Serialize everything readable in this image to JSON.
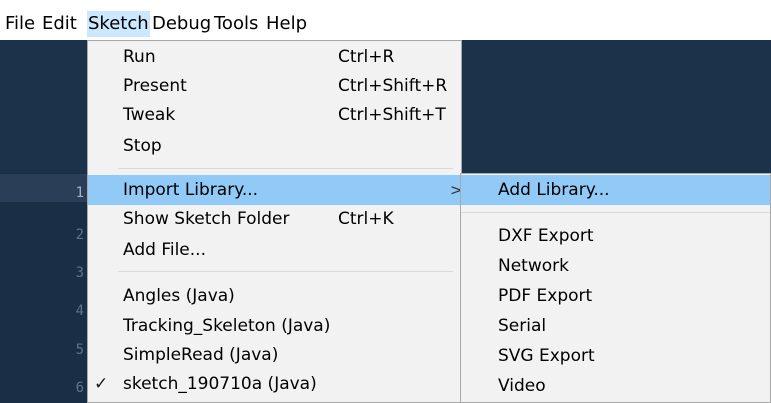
{
  "menubar": {
    "file": "File",
    "edit": "Edit",
    "sketch": "Sketch",
    "debug": "Debug",
    "tools": "Tools",
    "help": "Help"
  },
  "editor": {
    "line_numbers": [
      "1",
      "2",
      "3",
      "4",
      "5",
      "6"
    ]
  },
  "sketch_menu": {
    "run": "Run",
    "run_shortcut": "Ctrl+R",
    "present": "Present",
    "present_shortcut": "Ctrl+Shift+R",
    "tweak": "Tweak",
    "tweak_shortcut": "Ctrl+Shift+T",
    "stop": "Stop",
    "import_library": "Import Library...",
    "submenu_arrow": ">",
    "show_sketch_folder": "Show Sketch Folder",
    "show_sketch_folder_shortcut": "Ctrl+K",
    "add_file": "Add File...",
    "recent": [
      "Angles (Java)",
      "Tracking_Skeleton (Java)",
      "SimpleRead (Java)",
      "sketch_190710a (Java)"
    ],
    "check_mark": "✓"
  },
  "import_submenu": {
    "add_library": "Add Library...",
    "libraries": [
      "DXF Export",
      "Network",
      "PDF Export",
      "Serial",
      "SVG Export",
      "Video"
    ]
  },
  "colors": {
    "menu_highlight": "#91c9f7",
    "menubar_active": "#cce8ff",
    "editor_bg": "#0d2236"
  }
}
